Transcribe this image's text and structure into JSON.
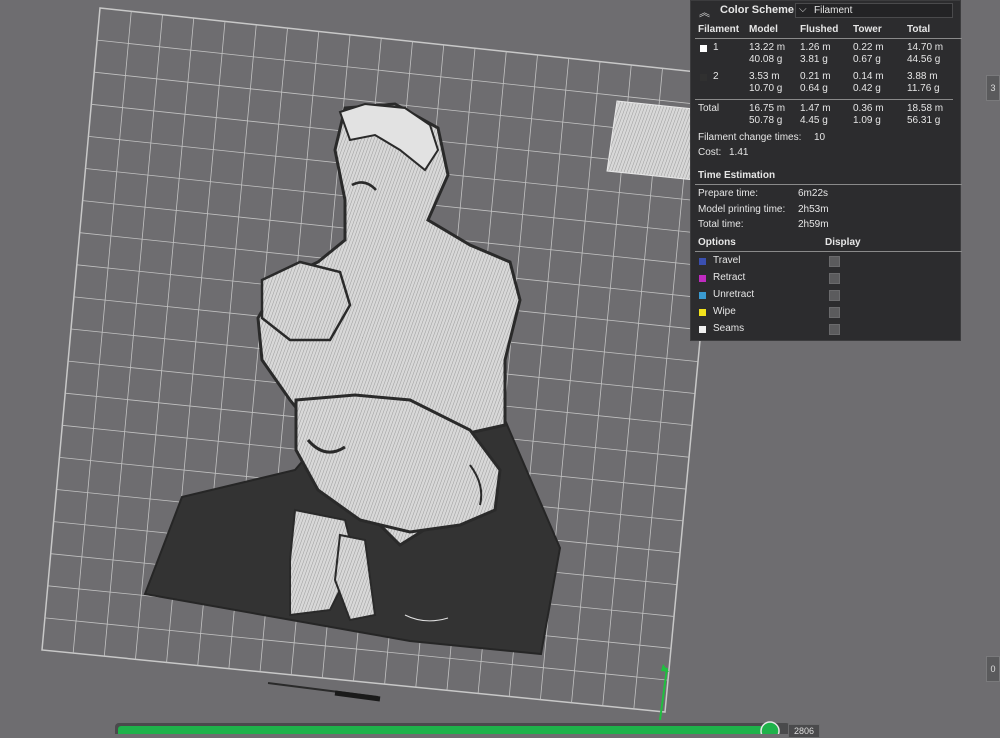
{
  "panel": {
    "title": "Color Scheme",
    "scheme_value": "Filament",
    "headers": [
      "Filament",
      "Model",
      "Flushed",
      "Tower",
      "Total"
    ],
    "rows": [
      {
        "id": "1",
        "swatch": "#ffffff",
        "model": [
          "13.22 m",
          "40.08 g"
        ],
        "flushed": [
          "1.26 m",
          "3.81 g"
        ],
        "tower": [
          "0.22 m",
          "0.67 g"
        ],
        "total": [
          "14.70 m",
          "44.56 g"
        ]
      },
      {
        "id": "2",
        "swatch": "#303030",
        "model": [
          "3.53 m",
          "10.70 g"
        ],
        "flushed": [
          "0.21 m",
          "0.64 g"
        ],
        "tower": [
          "0.14 m",
          "0.42 g"
        ],
        "total": [
          "3.88 m",
          "11.76 g"
        ]
      }
    ],
    "total_row": {
      "label": "Total",
      "model": [
        "16.75 m",
        "50.78 g"
      ],
      "flushed": [
        "1.47 m",
        "4.45 g"
      ],
      "tower": [
        "0.36 m",
        "1.09 g"
      ],
      "total": [
        "18.58 m",
        "56.31 g"
      ]
    },
    "change_times_label": "Filament change times:",
    "change_times_value": "10",
    "cost_label": "Cost:",
    "cost_value": "1.41",
    "time_title": "Time Estimation",
    "prepare_label": "Prepare time:",
    "prepare_value": "6m22s",
    "model_time_label": "Model printing time:",
    "model_time_value": "2h53m",
    "total_time_label": "Total time:",
    "total_time_value": "2h59m",
    "options_label": "Options",
    "display_label": "Display",
    "options": [
      {
        "label": "Travel",
        "color": "#3a4fb0"
      },
      {
        "label": "Retract",
        "color": "#c02bc0"
      },
      {
        "label": "Unretract",
        "color": "#3a9ad0"
      },
      {
        "label": "Wipe",
        "color": "#f2e21c"
      },
      {
        "label": "Seams",
        "color": "#f0f0f0"
      }
    ]
  },
  "slider": {
    "value_label": "2806",
    "fill": 1.0
  },
  "side": {
    "top_label": "3",
    "bottom_label": "0"
  }
}
